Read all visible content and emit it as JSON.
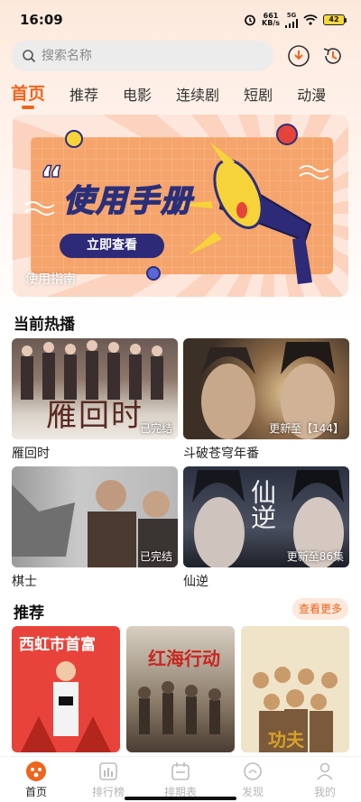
{
  "status_bar": {
    "time": "16:09",
    "net_speed_value": "661",
    "net_speed_unit": "KB/s",
    "signal_label": "5G",
    "battery": "42"
  },
  "search": {
    "placeholder": "搜索名称"
  },
  "tabs": [
    {
      "label": "首页",
      "active": true
    },
    {
      "label": "推荐"
    },
    {
      "label": "电影"
    },
    {
      "label": "连续剧"
    },
    {
      "label": "短剧"
    },
    {
      "label": "动漫"
    }
  ],
  "banner": {
    "quote_mark": "“",
    "title": "使用手册",
    "button": "立即查看",
    "caption": "使用指南"
  },
  "hot": {
    "title": "当前热播",
    "items": [
      {
        "name": "雁回时",
        "badge": "已完结",
        "poster_text": "雁回时"
      },
      {
        "name": "斗破苍穹年番",
        "badge": "更新至【144】"
      },
      {
        "name": "棋士",
        "badge": "已完结"
      },
      {
        "name": "仙逆",
        "badge": "更新至86集",
        "poster_text": "仙逆"
      }
    ]
  },
  "recommend": {
    "title": "推荐",
    "more": "查看更多",
    "items": [
      {
        "poster_text": "西虹市首富"
      },
      {
        "poster_text": "红海行动"
      },
      {
        "poster_text": "功夫"
      }
    ]
  },
  "bottom_nav": [
    {
      "label": "首页",
      "icon": "home-icon",
      "active": true
    },
    {
      "label": "排行榜",
      "icon": "ranking-icon"
    },
    {
      "label": "排期表",
      "icon": "schedule-icon"
    },
    {
      "label": "发现",
      "icon": "discover-icon"
    },
    {
      "label": "我的",
      "icon": "profile-icon"
    }
  ],
  "colors": {
    "accent": "#f0641e",
    "banner_button": "#2d2a78"
  }
}
